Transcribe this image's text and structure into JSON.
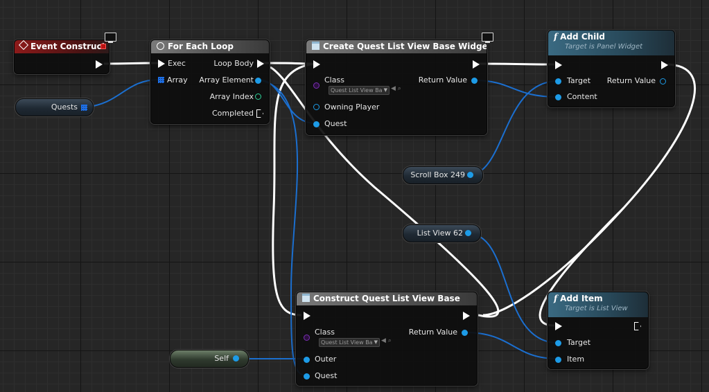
{
  "nodes": {
    "event_construct": {
      "title": "Event Construct"
    },
    "for_each_loop": {
      "title": "For Each Loop",
      "pins": {
        "exec": "Exec",
        "array": "Array",
        "loop_body": "Loop Body",
        "array_element": "Array Element",
        "array_index": "Array Index",
        "completed": "Completed"
      }
    },
    "create_widget": {
      "title": "Create Quest List View Base Widget",
      "pins": {
        "class": "Class",
        "class_value": "Quest List View Ba",
        "return_value": "Return Value",
        "owning_player": "Owning Player",
        "quest": "Quest"
      }
    },
    "add_child": {
      "title": "Add Child",
      "subtitle": "Target is Panel Widget",
      "pins": {
        "target": "Target",
        "return_value": "Return Value",
        "content": "Content"
      }
    },
    "construct_object": {
      "title": "Construct Quest List View Base",
      "pins": {
        "class": "Class",
        "class_value": "Quest List View Ba",
        "return_value": "Return Value",
        "outer": "Outer",
        "quest": "Quest"
      }
    },
    "add_item": {
      "title": "Add Item",
      "subtitle": "Target is List View",
      "pins": {
        "target": "Target",
        "item": "Item"
      }
    }
  },
  "variables": {
    "quests": "Quests",
    "scroll_box": "Scroll Box 249",
    "list_view": "List View 62",
    "self": "Self"
  },
  "icons": {
    "event": "event-diamond-icon",
    "loop": "loop-icon",
    "widget": "widget-icon",
    "function": "function-icon",
    "client_only": "monitor-icon"
  },
  "colors": {
    "event_header": "#8d1a1a",
    "flow_header": "#7a7a7a",
    "call_header": "#3a6a82",
    "object_pin": "#1d9be7",
    "index_pin": "#2ed49a",
    "class_pin": "#7a2fb3",
    "exec_wire": "#ffffff",
    "data_wire": "#1b6fd0"
  }
}
